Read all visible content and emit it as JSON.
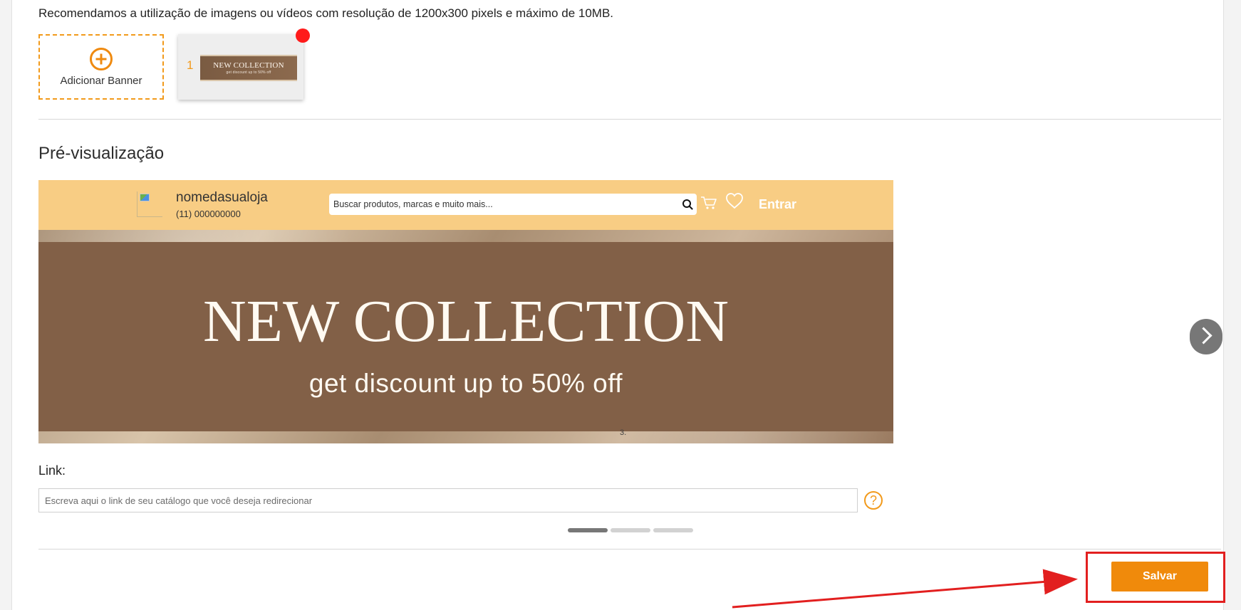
{
  "recommendation": {
    "text": "Recomendamos a utilização de imagens ou vídeos com resolução de 1200x300 pixels e máximo de 10MB."
  },
  "banner_upload": {
    "add_button_label": "Adicionar Banner",
    "thumbnail": {
      "number": "1",
      "title": "NEW COLLECTION",
      "subtitle": "get discount up to 50% off"
    }
  },
  "preview": {
    "title": "Pré-visualização",
    "store": {
      "name": "nomedasualoja",
      "phone": "(11) 000000000",
      "search_placeholder": "Buscar produtos, marcas e muito mais...",
      "login": "Entrar"
    },
    "banner": {
      "title": "NEW COLLECTION",
      "subtitle": "get discount up to 50% off",
      "indicator": "3."
    },
    "slider_dots": {
      "active_index": 0,
      "count": 3
    }
  },
  "link": {
    "label": "Link:",
    "placeholder": "Escreva aqui o link de seu catálogo que você deseja redirecionar",
    "help_symbol": "?"
  },
  "actions": {
    "save_label": "Salvar"
  },
  "colors": {
    "accent_orange": "#f08a0b",
    "highlight_red": "#e21f1f",
    "notification_red": "#ff1b1b",
    "store_header": "#f8cd84",
    "banner_brown": "#826047"
  },
  "icons": {
    "add": "plus-circle-icon",
    "search": "search-icon",
    "cart": "cart-icon",
    "favorite": "heart-icon",
    "help": "question-circle-icon",
    "next": "chevron-right-icon"
  }
}
